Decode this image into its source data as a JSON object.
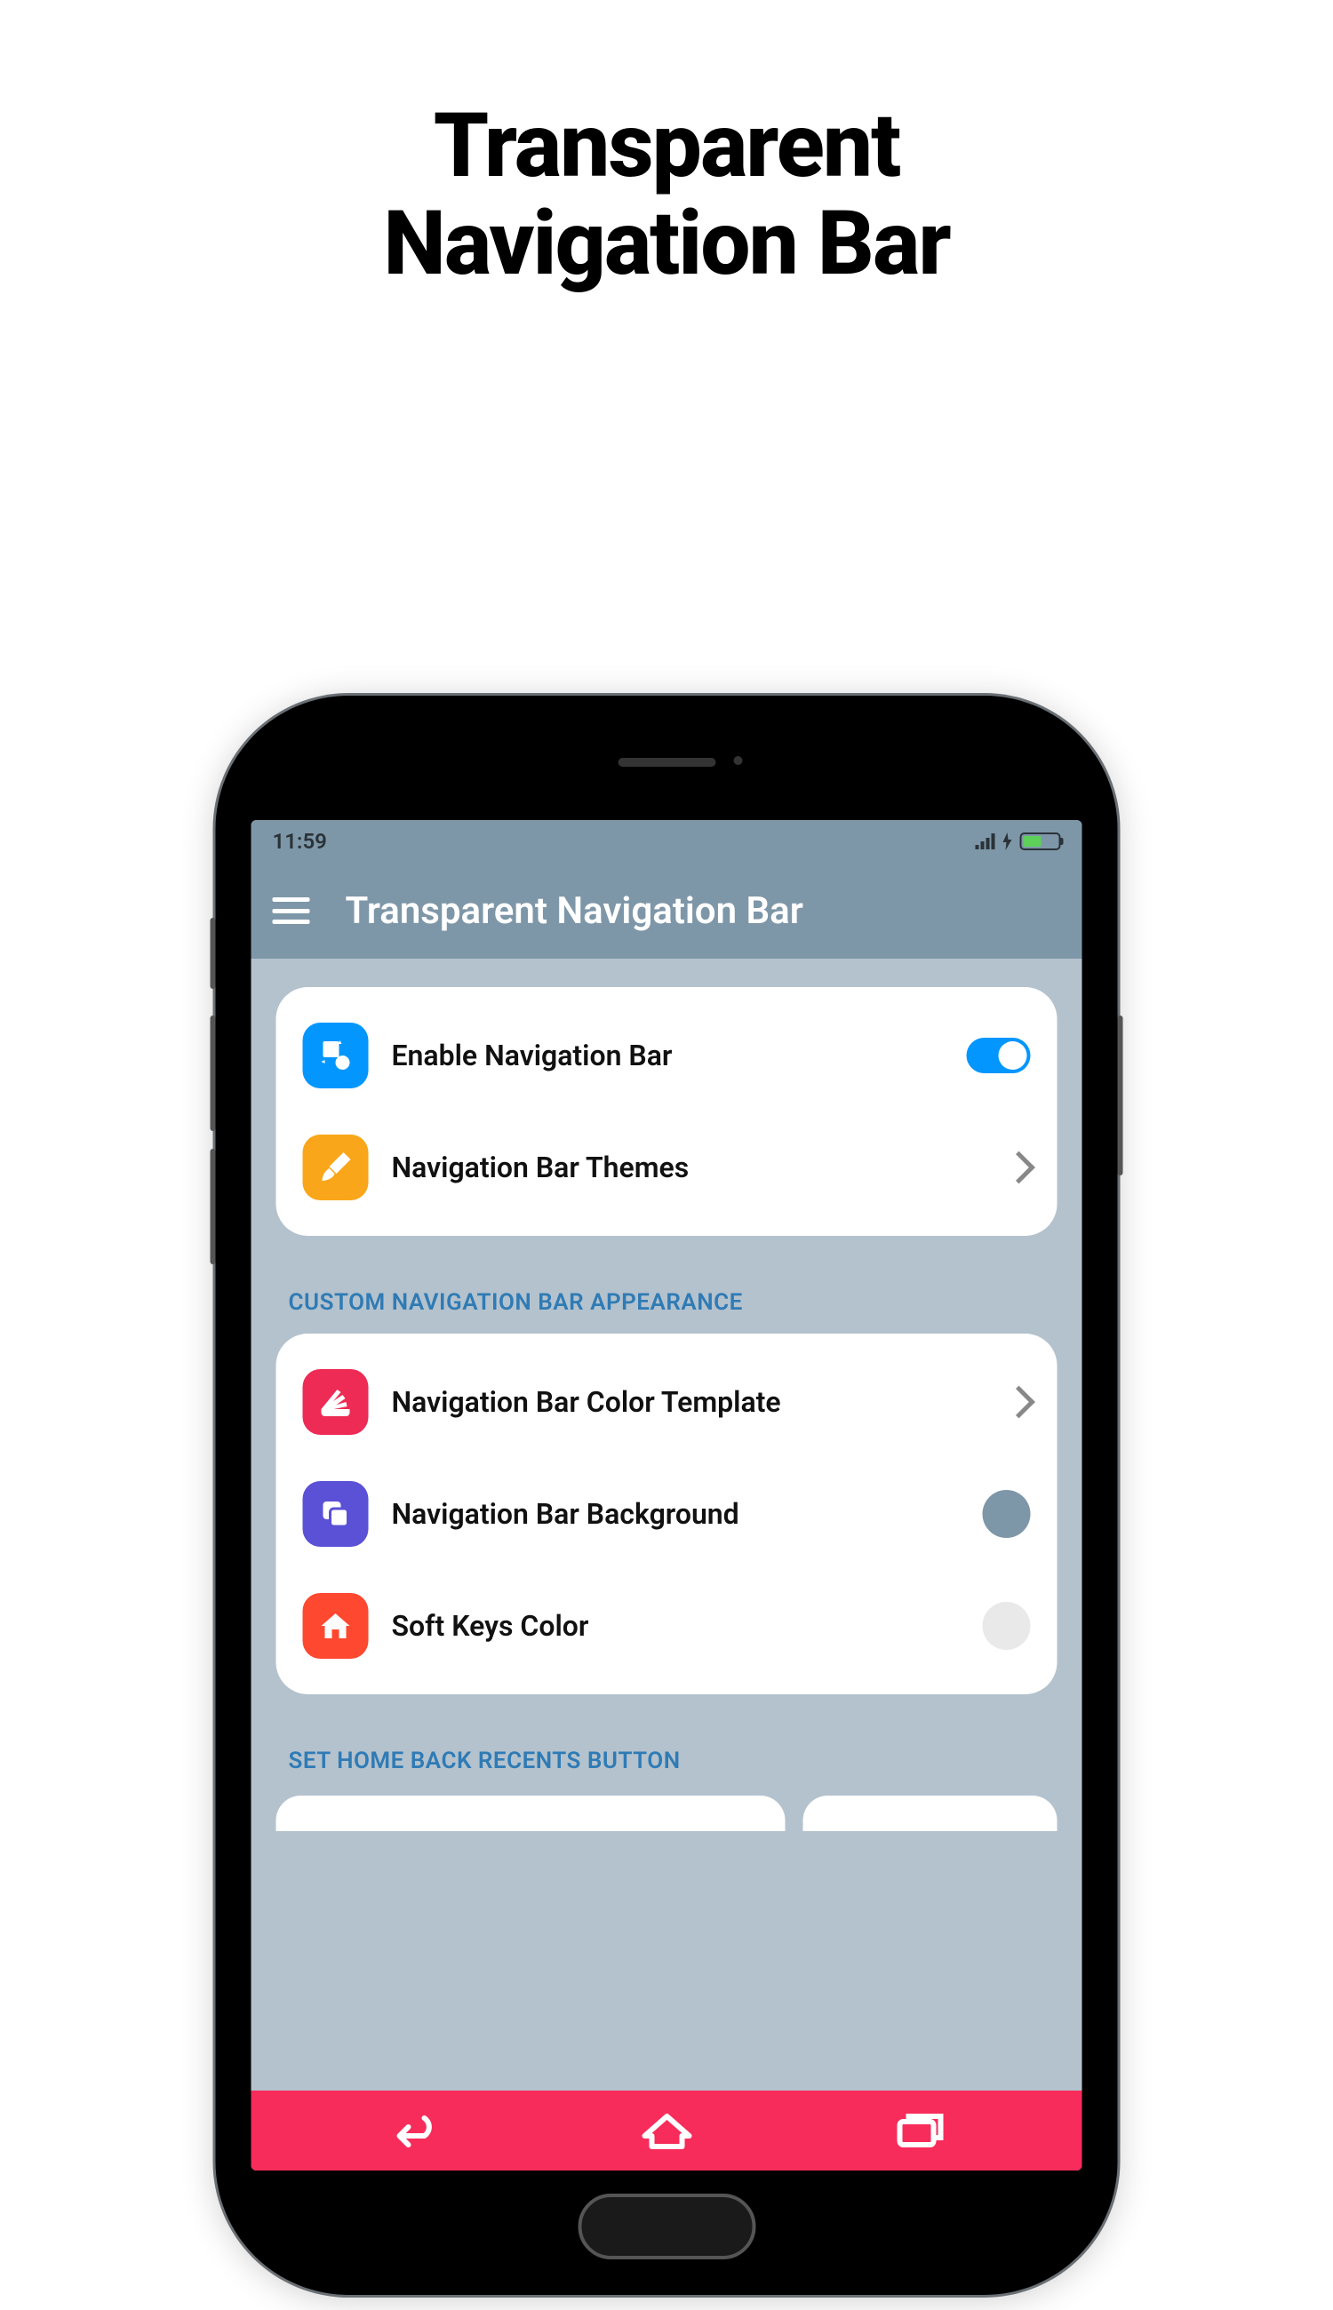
{
  "page_heading": "Transparent\nNavigation Bar",
  "status": {
    "time": "11:59"
  },
  "appbar": {
    "title": "Transparent Navigation Bar"
  },
  "section1": {
    "enable_label": "Enable Navigation Bar",
    "enable_on": true,
    "themes_label": "Navigation Bar Themes"
  },
  "section2": {
    "heading": "CUSTOM NAVIGATION BAR APPEARANCE",
    "template_label": "Navigation Bar Color Template",
    "background_label": "Navigation Bar Background",
    "background_color": "#7e97a8",
    "softkeys_label": "Soft Keys Color",
    "softkeys_color": "#e9e9e9"
  },
  "section3": {
    "heading": "SET HOME BACK RECENTS BUTTON"
  },
  "colors": {
    "accent": "#0396ff",
    "navbar": "#f72c5b",
    "chrome": "#7e97a8"
  }
}
